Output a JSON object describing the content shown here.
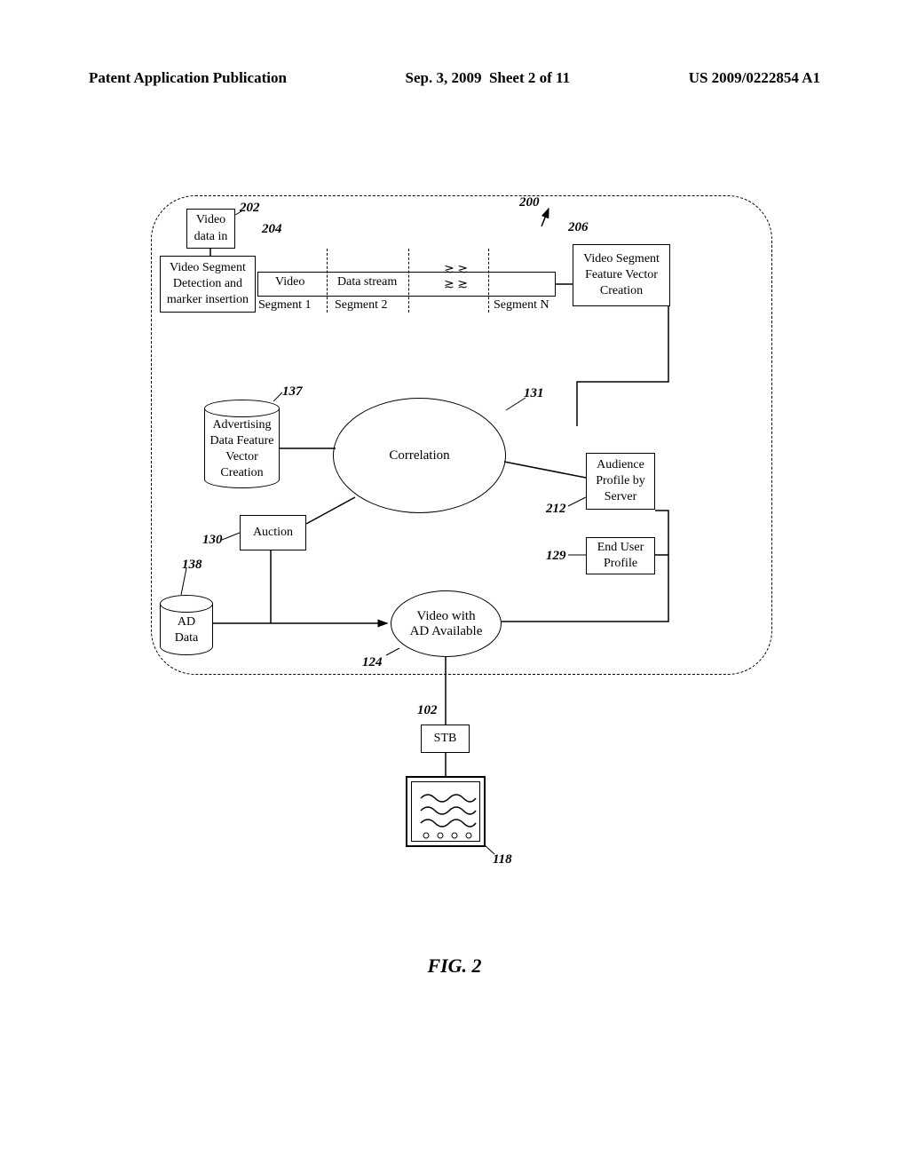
{
  "header": {
    "left": "Patent Application Publication",
    "center_date": "Sep. 3, 2009",
    "center_sheet": "Sheet 2 of 11",
    "right": "US 2009/0222854 A1"
  },
  "blocks": {
    "video_data_in": "Video\ndata in",
    "segment_detection": "Video Segment\nDetection and\nmarker insertion",
    "feature_vector": "Video Segment\nFeature Vector\nCreation",
    "ad_feature": "Advertising\nData Feature\nVector\nCreation",
    "correlation": "Correlation",
    "audience": "Audience\nProfile by\nServer",
    "end_user": "End User\nProfile",
    "auction": "Auction",
    "ad_data": "AD\nData",
    "video_ad": "Video with\nAD Available",
    "stb": "STB"
  },
  "stream_labels": {
    "video": "Video",
    "data_stream": "Data stream",
    "seg1": "Segment 1",
    "seg2": "Segment 2",
    "segN": "Segment N"
  },
  "refnums": {
    "r202": "202",
    "r204": "204",
    "r200": "200",
    "r206": "206",
    "r137": "137",
    "r131": "131",
    "r212": "212",
    "r129": "129",
    "r130": "130",
    "r138": "138",
    "r124": "124",
    "r102": "102",
    "r118": "118"
  },
  "figure": "FIG. 2",
  "chart_data": {
    "type": "diagram",
    "title": "FIG. 2",
    "description": "Block diagram of video advertising system with segment detection, feature vector creation, correlation, auction, and delivery to STB/TV",
    "nodes": [
      {
        "id": "202",
        "label": "Video data in",
        "shape": "rect"
      },
      {
        "id": "204",
        "label": "Video Segment Detection and marker insertion",
        "shape": "rect"
      },
      {
        "id": "stream",
        "label": "Video Data stream",
        "segments": [
          "Segment 1",
          "Segment 2",
          "Segment N"
        ],
        "shape": "stream"
      },
      {
        "id": "206",
        "label": "Video Segment Feature Vector Creation",
        "shape": "rect"
      },
      {
        "id": "137",
        "label": "Advertising Data Feature Vector Creation",
        "shape": "cylinder"
      },
      {
        "id": "131",
        "label": "Correlation",
        "shape": "circle"
      },
      {
        "id": "212",
        "label": "Audience Profile by Server",
        "shape": "rect"
      },
      {
        "id": "129",
        "label": "End User Profile",
        "shape": "rect"
      },
      {
        "id": "130",
        "label": "Auction",
        "shape": "rect"
      },
      {
        "id": "138",
        "label": "AD Data",
        "shape": "cylinder"
      },
      {
        "id": "124",
        "label": "Video with AD Available",
        "shape": "circle"
      },
      {
        "id": "102",
        "label": "STB",
        "shape": "rect"
      },
      {
        "id": "118",
        "label": "TV",
        "shape": "tv"
      },
      {
        "id": "200",
        "label": "System boundary",
        "shape": "dashed-cloud"
      }
    ],
    "edges": [
      {
        "from": "202",
        "to": "204"
      },
      {
        "from": "204",
        "to": "stream"
      },
      {
        "from": "stream",
        "to": "206"
      },
      {
        "from": "206",
        "to": "131"
      },
      {
        "from": "137",
        "to": "131"
      },
      {
        "from": "212",
        "to": "131"
      },
      {
        "from": "129",
        "to": "131"
      },
      {
        "from": "131",
        "to": "130"
      },
      {
        "from": "130",
        "to": "124"
      },
      {
        "from": "138",
        "to": "124"
      },
      {
        "from": "129",
        "to": "124"
      },
      {
        "from": "124",
        "to": "102"
      },
      {
        "from": "102",
        "to": "118"
      }
    ]
  }
}
